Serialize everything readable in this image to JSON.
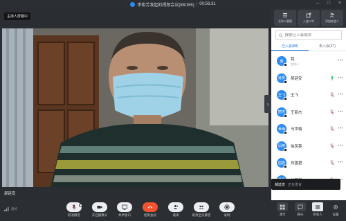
{
  "window": {
    "title": "李俊芳发起的视频会议(88/155)",
    "timer": "00:56:31"
  },
  "stage": {
    "host_tag": "主持人屏幕中",
    "speaker_name": "郝廷安"
  },
  "panel": {
    "tools": [
      {
        "label": "主持人管理",
        "icon": "host-manage-icon"
      },
      {
        "label": "入会口令",
        "icon": "share-code-icon"
      },
      {
        "label": "添加参会人",
        "icon": "add-person-icon"
      }
    ],
    "search_placeholder": "搜索已入会成员",
    "tabs": [
      "已入会(88)",
      "未入会(67)"
    ],
    "participants": [
      {
        "avatar": "我",
        "name": "我",
        "sub": "主持人",
        "mic": false
      },
      {
        "avatar": "廷安",
        "name": "郝廷安",
        "sub": "",
        "mic": true
      },
      {
        "avatar": "王飞",
        "name": "王飞",
        "sub": "",
        "mic": true
      },
      {
        "avatar": "丽杰",
        "name": "王丽杰",
        "sub": "",
        "mic": true
      },
      {
        "avatar": "世梅",
        "name": "马世梅",
        "sub": "",
        "mic": true
      },
      {
        "avatar": "凤英",
        "name": "徐凤英",
        "sub": "",
        "mic": true
      },
      {
        "avatar": "国君",
        "name": "刘国君",
        "sub": "",
        "mic": true
      },
      {
        "avatar": "英星",
        "name": "刘英星",
        "sub": "",
        "mic": true
      }
    ],
    "speaking_name": "郝廷安",
    "speaking_status": "正在发言"
  },
  "toolbar": {
    "signal_label": "良好",
    "buttons": [
      {
        "label": "取消静音",
        "icon": "mic-off-icon"
      },
      {
        "label": "开启摄像头",
        "icon": "camera-icon"
      },
      {
        "label": "共享窗口",
        "icon": "share-screen-icon"
      },
      {
        "label": "结束会议",
        "icon": "hangup-icon"
      },
      {
        "label": "邀请",
        "icon": "invite-icon"
      },
      {
        "label": "取消全员静音",
        "icon": "mute-all-icon"
      },
      {
        "label": "录制",
        "icon": "record-icon"
      }
    ],
    "right_buttons": [
      {
        "label": "演示",
        "icon": "layout-icon"
      },
      {
        "label": "聊天",
        "icon": "chat-icon"
      },
      {
        "label": "参会人",
        "icon": "participants-icon"
      },
      {
        "label": "设置",
        "icon": "settings-icon"
      }
    ]
  },
  "colors": {
    "accent": "#1a73e8",
    "avatar": "#2d8cf0",
    "hangup": "#f25430"
  }
}
